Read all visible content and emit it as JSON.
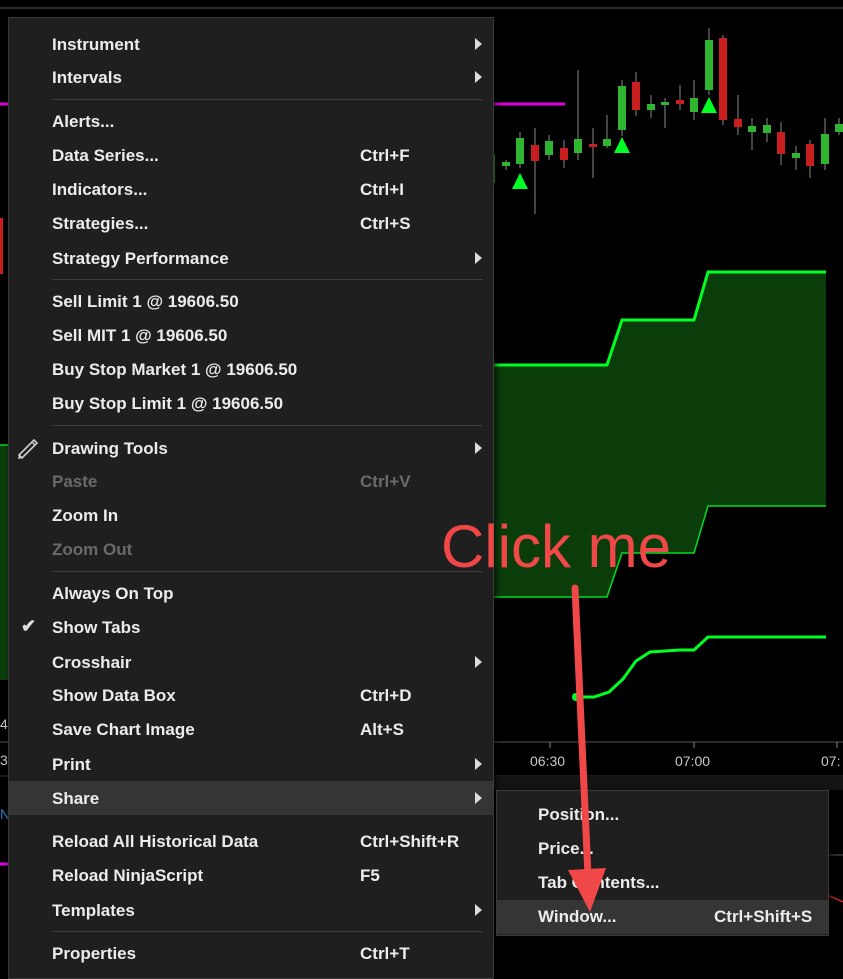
{
  "chart": {
    "time_labels": [
      "06:30",
      "07:00",
      "07:"
    ],
    "left_edge_labels": [
      "4",
      "3",
      "N"
    ],
    "colors": {
      "band": "#00ff22",
      "band_fill": "#0b3d0b",
      "up_candle": "#2fb52f",
      "down_candle": "#c81e1e",
      "level_line": "#e000e0",
      "marker": "#00ff22"
    }
  },
  "context_menu": {
    "items": [
      {
        "label": "Instrument",
        "shortcut": "",
        "submenu": true
      },
      {
        "label": "Intervals",
        "shortcut": "",
        "submenu": true
      },
      {
        "label": "Alerts...",
        "shortcut": ""
      },
      {
        "label": "Data Series...",
        "shortcut": "Ctrl+F"
      },
      {
        "label": "Indicators...",
        "shortcut": "Ctrl+I"
      },
      {
        "label": "Strategies...",
        "shortcut": "Ctrl+S"
      },
      {
        "label": "Strategy Performance",
        "shortcut": "",
        "submenu": true
      },
      {
        "label": "Sell Limit 1 @ 19606.50",
        "shortcut": ""
      },
      {
        "label": "Sell MIT 1 @ 19606.50",
        "shortcut": ""
      },
      {
        "label": "Buy Stop Market 1 @ 19606.50",
        "shortcut": ""
      },
      {
        "label": "Buy Stop Limit 1 @ 19606.50",
        "shortcut": ""
      },
      {
        "label": "Drawing Tools",
        "shortcut": "",
        "submenu": true,
        "icon": "pencil-icon"
      },
      {
        "label": "Paste",
        "shortcut": "Ctrl+V",
        "disabled": true
      },
      {
        "label": "Zoom In",
        "shortcut": ""
      },
      {
        "label": "Zoom Out",
        "shortcut": "",
        "disabled": true
      },
      {
        "label": "Always On Top",
        "shortcut": ""
      },
      {
        "label": "Show Tabs",
        "shortcut": "",
        "checked": true
      },
      {
        "label": "Crosshair",
        "shortcut": "",
        "submenu": true
      },
      {
        "label": "Show Data Box",
        "shortcut": "Ctrl+D"
      },
      {
        "label": "Save Chart Image",
        "shortcut": "Alt+S"
      },
      {
        "label": "Print",
        "shortcut": "",
        "submenu": true
      },
      {
        "label": "Share",
        "shortcut": "",
        "submenu": true,
        "highlighted": true
      },
      {
        "label": "Reload All Historical Data",
        "shortcut": "Ctrl+Shift+R"
      },
      {
        "label": "Reload NinjaScript",
        "shortcut": "F5"
      },
      {
        "label": "Templates",
        "shortcut": "",
        "submenu": true
      },
      {
        "label": "Properties",
        "shortcut": "Ctrl+T"
      }
    ]
  },
  "share_submenu": {
    "items": [
      {
        "label": "Position...",
        "shortcut": ""
      },
      {
        "label": "Price...",
        "shortcut": ""
      },
      {
        "label": "Tab Contents...",
        "shortcut": ""
      },
      {
        "label": "Window...",
        "shortcut": "Ctrl+Shift+S",
        "highlighted": true
      }
    ]
  },
  "annotation": {
    "text": "Click me",
    "color": "#f04848"
  }
}
